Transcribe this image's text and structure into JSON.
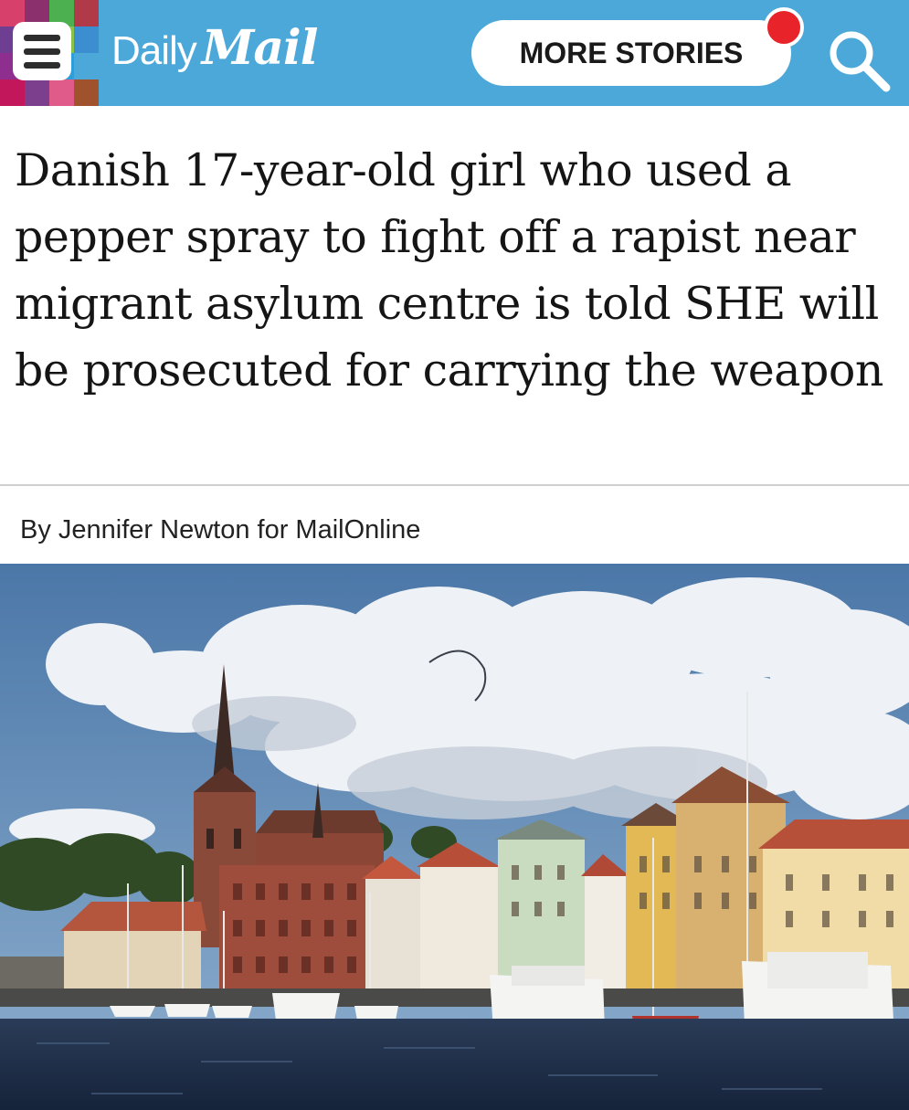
{
  "header": {
    "brand_daily": "Daily",
    "brand_mail": "Mail",
    "more_stories_label": "MORE STORIES",
    "menu_icon": "hamburger-menu-icon",
    "search_icon": "search-icon",
    "bar_color": "#4ca8d8",
    "notification_color": "#e8242a"
  },
  "article": {
    "headline": "Danish 17-year-old girl who used a pepper spray to fight off a rapist near migrant asylum centre is told SHE will be prosecuted for carrying the weapon",
    "byline": "By Jennifer Newton for MailOnline"
  }
}
